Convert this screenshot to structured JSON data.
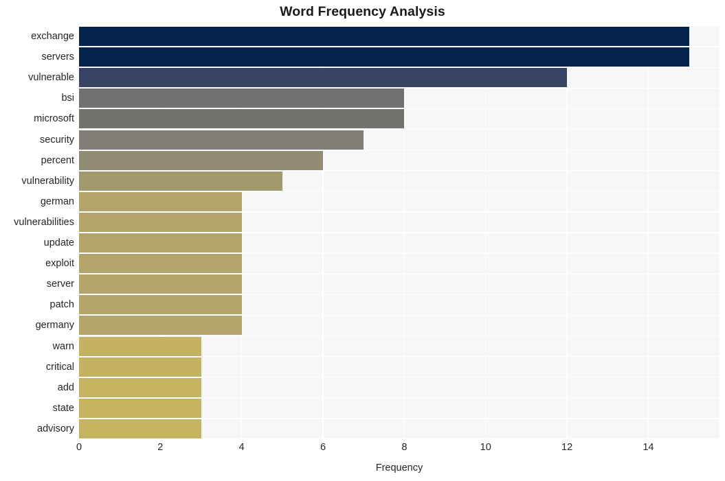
{
  "chart_data": {
    "type": "bar",
    "orientation": "horizontal",
    "title": "Word Frequency Analysis",
    "xlabel": "Frequency",
    "ylabel": "",
    "xlim": [
      0,
      15.75
    ],
    "ylim_categories": 20,
    "grid": true,
    "legend": null,
    "xticks": [
      "0",
      "2",
      "4",
      "6",
      "8",
      "10",
      "12",
      "14"
    ],
    "xtick_values": [
      0,
      2,
      4,
      6,
      8,
      10,
      12,
      14
    ],
    "categories": [
      "exchange",
      "servers",
      "vulnerable",
      "bsi",
      "microsoft",
      "security",
      "percent",
      "vulnerability",
      "german",
      "vulnerabilities",
      "update",
      "exploit",
      "server",
      "patch",
      "germany",
      "warn",
      "critical",
      "add",
      "state",
      "advisory"
    ],
    "values": [
      15,
      15,
      12,
      8,
      8,
      7,
      6,
      5,
      4,
      4,
      4,
      4,
      4,
      4,
      4,
      3,
      3,
      3,
      3,
      3
    ],
    "bar_colors": [
      "#04234f",
      "#04234f",
      "#374463",
      "#71716f",
      "#74726f",
      "#807e76",
      "#908d72",
      "#a0996e",
      "#b3a46c",
      "#b3a46c",
      "#b3a46c",
      "#b3a46c",
      "#b3a46c",
      "#b3a46c",
      "#b3a46c",
      "#c2b262",
      "#c2b262",
      "#c4b461",
      "#c4b461",
      "#c4b461"
    ]
  },
  "style": {
    "plot_background": "#f7f7f7",
    "figure_background": "#ffffff",
    "gridline_color": "#ffffff",
    "tick_label_color": "#262626",
    "title_color": "#1a1a1a"
  }
}
